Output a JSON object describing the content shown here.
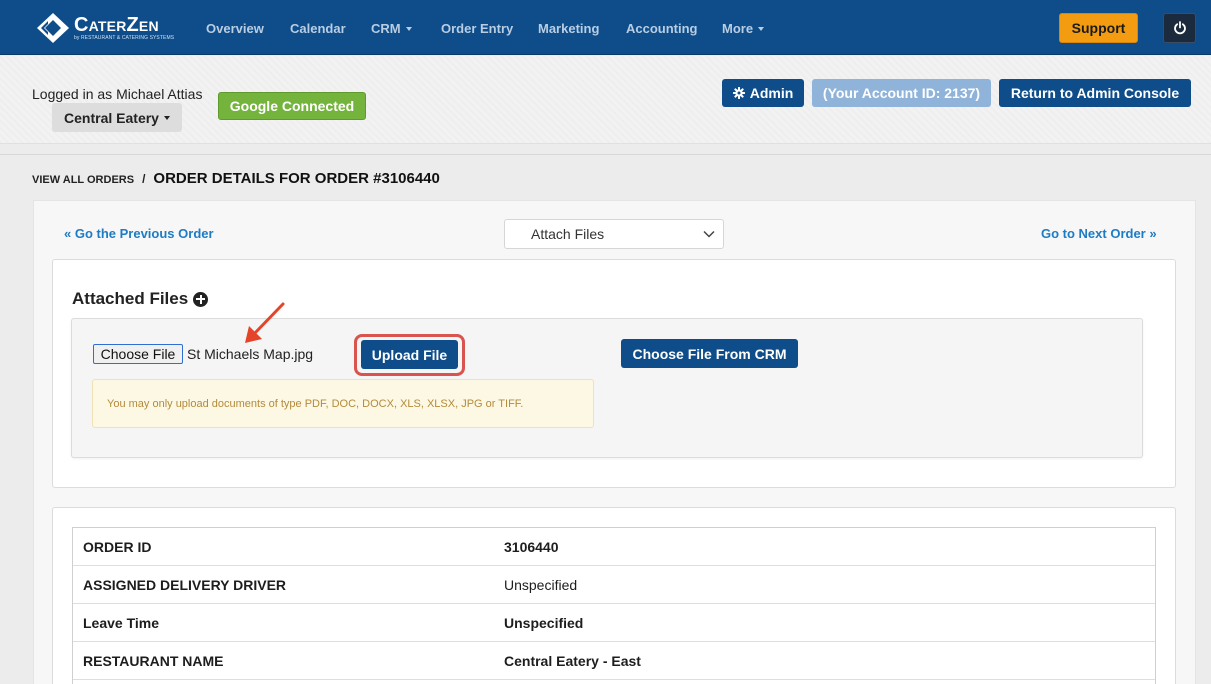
{
  "brand": {
    "name": "CaterZen",
    "tagline": "by RESTAURANT & CATERING SYSTEMS"
  },
  "nav": {
    "items": [
      {
        "label": "Overview"
      },
      {
        "label": "Calendar"
      },
      {
        "label": "CRM"
      },
      {
        "label": "Order Entry"
      },
      {
        "label": "Marketing"
      },
      {
        "label": "Accounting"
      },
      {
        "label": "More"
      }
    ],
    "support_label": "Support"
  },
  "header": {
    "logged_in": "Logged in as Michael Attias",
    "venue": "Central Eatery",
    "google_status": "Google Connected",
    "admin_label": "Admin",
    "account_id": "(Your Account ID: 2137)",
    "return_label": "Return to Admin Console"
  },
  "breadcrumb": {
    "parent": "VIEW ALL ORDERS",
    "separator": "/",
    "current": "ORDER DETAILS FOR ORDER #3106440"
  },
  "order_nav": {
    "prev_label": "« Go the Previous Order",
    "next_label": "Go to Next Order »",
    "select_value": "Attach Files"
  },
  "attachments": {
    "title": "Attached Files",
    "choose_file_label": "Choose File",
    "selected_file": "St Michaels Map.jpg",
    "upload_label": "Upload File",
    "crm_label": "Choose File From CRM",
    "notice": "You may only upload documents of type PDF, DOC, DOCX, XLS, XLSX, JPG or TIFF."
  },
  "details": {
    "rows": [
      {
        "key": "ORDER ID",
        "value": "3106440"
      },
      {
        "key": "ASSIGNED DELIVERY DRIVER",
        "value": "Unspecified"
      },
      {
        "key": "Leave Time",
        "value": "Unspecified"
      },
      {
        "key": "RESTAURANT NAME",
        "value": "Central Eatery - East"
      }
    ]
  },
  "colors": {
    "nav_bg": "#0e4d8a",
    "primary_button": "#0e4d8a",
    "support": "#f39c12",
    "google": "#74b43c",
    "link": "#1d7cc4",
    "highlight": "#d9534f"
  }
}
